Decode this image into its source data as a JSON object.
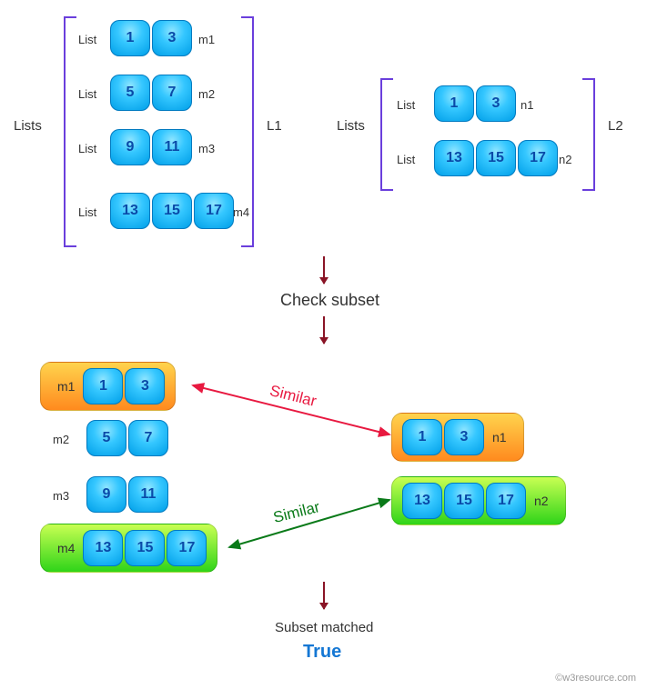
{
  "labels": {
    "lists": "Lists",
    "list": "List",
    "l1": "L1",
    "l2": "L2",
    "check": "Check subset",
    "matched": "Subset matched",
    "result": "True",
    "similar": "Similar",
    "watermark": "©w3resource.com"
  },
  "L1": {
    "tag": "L1",
    "rows": [
      {
        "label": "m1",
        "values": [
          1,
          3
        ]
      },
      {
        "label": "m2",
        "values": [
          5,
          7
        ]
      },
      {
        "label": "m3",
        "values": [
          9,
          11
        ]
      },
      {
        "label": "m4",
        "values": [
          13,
          15,
          17
        ]
      }
    ]
  },
  "L2": {
    "tag": "L2",
    "rows": [
      {
        "label": "n1",
        "values": [
          1,
          3
        ]
      },
      {
        "label": "n2",
        "values": [
          13,
          15,
          17
        ]
      }
    ]
  },
  "compare": {
    "left": [
      {
        "label": "m1",
        "values": [
          1,
          3
        ],
        "highlight": "orange"
      },
      {
        "label": "m2",
        "values": [
          5,
          7
        ],
        "highlight": null
      },
      {
        "label": "m3",
        "values": [
          9,
          11
        ],
        "highlight": null
      },
      {
        "label": "m4",
        "values": [
          13,
          15,
          17
        ],
        "highlight": "green"
      }
    ],
    "right": [
      {
        "label": "n1",
        "values": [
          1,
          3
        ],
        "highlight": "orange"
      },
      {
        "label": "n2",
        "values": [
          13,
          15,
          17
        ],
        "highlight": "green"
      }
    ],
    "links": [
      {
        "from": "m1",
        "to": "n1",
        "text": "Similar",
        "color": "#e81940"
      },
      {
        "from": "m4",
        "to": "n2",
        "text": "Similar",
        "color": "#0a7a19"
      }
    ]
  },
  "result": true
}
